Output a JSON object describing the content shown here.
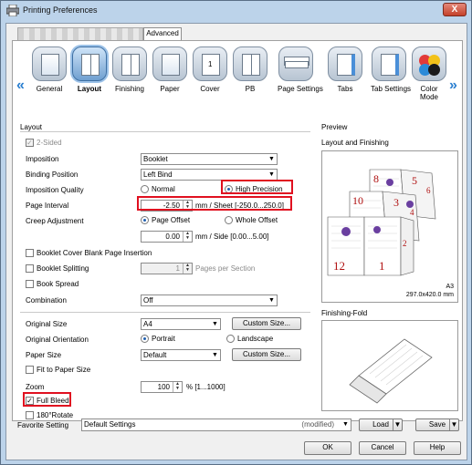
{
  "window": {
    "title": "Printing Preferences",
    "close_label": "X"
  },
  "tabs": {
    "advanced": "Advanced"
  },
  "icon_bar": {
    "items": [
      {
        "label": "General",
        "icon": "general-icon",
        "selected": false
      },
      {
        "label": "Layout",
        "icon": "layout-icon",
        "selected": true
      },
      {
        "label": "Finishing",
        "icon": "finishing-icon",
        "selected": false
      },
      {
        "label": "Paper",
        "icon": "paper-icon",
        "selected": false
      },
      {
        "label": "Cover",
        "icon": "cover-icon",
        "selected": false
      },
      {
        "label": "PB",
        "icon": "pb-icon",
        "selected": false
      },
      {
        "label": "Page Settings",
        "icon": "page-settings-icon",
        "selected": false
      },
      {
        "label": "Tabs",
        "icon": "tabs-icon",
        "selected": false
      },
      {
        "label": "Tab Settings",
        "icon": "tab-settings-icon",
        "selected": false
      },
      {
        "label": "Color Mode",
        "icon": "color-mode-icon",
        "selected": false
      }
    ]
  },
  "layout": {
    "heading": "Layout",
    "two_sided": "2-Sided",
    "imposition": {
      "label": "Imposition",
      "value": "Booklet"
    },
    "binding_position": {
      "label": "Binding Position",
      "value": "Left Bind"
    },
    "imposition_quality": {
      "label": "Imposition Quality",
      "normal": "Normal",
      "high": "High Precision"
    },
    "page_interval": {
      "label": "Page Interval",
      "value": "-2.50",
      "unit": "mm / Sheet [-250.0...250.0]"
    },
    "creep": {
      "label": "Creep Adjustment",
      "page_offset": "Page Offset",
      "whole_offset": "Whole Offset",
      "value": "0.00",
      "unit": "mm / Side [0.00...5.00]"
    },
    "blank_insertion": "Booklet Cover Blank Page Insertion",
    "splitting": {
      "label": "Booklet Splitting",
      "value": "1",
      "unit": "Pages per Section"
    },
    "book_spread": "Book Spread",
    "combination": {
      "label": "Combination",
      "value": "Off"
    },
    "original_size": {
      "label": "Original Size",
      "value": "A4",
      "button": "Custom Size..."
    },
    "orientation": {
      "label": "Original Orientation",
      "portrait": "Portrait",
      "landscape": "Landscape"
    },
    "paper_size": {
      "label": "Paper Size",
      "value": "Default",
      "button": "Custom Size..."
    },
    "fit_to_paper": "Fit to Paper Size",
    "zoom": {
      "label": "Zoom",
      "value": "100",
      "unit": "% [1...1000]"
    },
    "full_bleed": "Full Bleed",
    "rotate": "180°Rotate"
  },
  "preview": {
    "heading": "Preview",
    "layout_finishing": "Layout and Finishing",
    "paper_name": "A3",
    "paper_dims": "297.0x420.0 mm",
    "finishing_fold": "Finishing-Fold",
    "page_numbers": [
      "8",
      "5",
      "6",
      "10",
      "3",
      "4",
      "12",
      "1",
      "2"
    ]
  },
  "favorite": {
    "label": "Favorite Setting",
    "value": "Default Settings",
    "modified": "(modified)",
    "load": "Load",
    "save": "Save"
  },
  "buttons": {
    "ok": "OK",
    "cancel": "Cancel",
    "help": "Help"
  },
  "colors": {
    "highlight": "#e01020",
    "selected_icon": "#6f9fd0"
  }
}
